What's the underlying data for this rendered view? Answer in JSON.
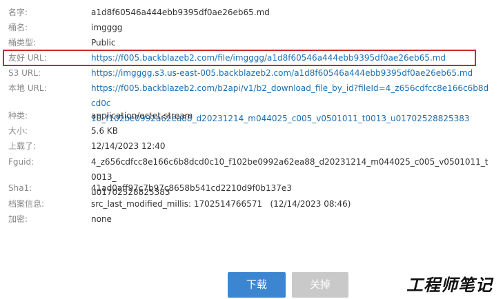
{
  "fields": {
    "name": {
      "label": "名字:",
      "value": "a1d8f60546a444ebb9395df0ae26eb65.md"
    },
    "bucket": {
      "label": "桶名:",
      "value": "imgggg"
    },
    "bucket_type": {
      "label": "桶类型:",
      "value": "Public"
    },
    "friendly_url": {
      "label": "友好 URL:",
      "value": "https://f005.backblazeb2.com/file/imgggg/a1d8f60546a444ebb9395df0ae26eb65.md"
    },
    "s3_url": {
      "label": "S3 URL:",
      "value": "https://imgggg.s3.us-east-005.backblazeb2.com/a1d8f60546a444ebb9395df0ae26eb65.md"
    },
    "native_url": {
      "label": "本地 URL:",
      "line1": "https://f005.backblazeb2.com/b2api/v1/b2_download_file_by_id?fileId=4_z656cdfcc8e166c6b8dcd0c",
      "line2": "10_f102be0992a62ea88_d20231214_m044025_c005_v0501011_t0013_u01702528825383"
    },
    "type": {
      "label": "种类:",
      "value": "application/octet-stream"
    },
    "size": {
      "label": "大小:",
      "value": "5.6 KB"
    },
    "uploaded": {
      "label": "上载了:",
      "value": "12/14/2023 12:40"
    },
    "fguid": {
      "label": "Fguid:",
      "line1": "4_z656cdfcc8e166c6b8dcd0c10_f102be0992a62ea88_d20231214_m044025_c005_v0501011_t0013_",
      "line2": "u01702528825383"
    },
    "sha1": {
      "label": "Sha1:",
      "value": "41ad0aff97c7b97c8658b541cd2210d9f0b137e3"
    },
    "file_info": {
      "label": "档案信息:",
      "value": "src_last_modified_millis: 1702514766571   (12/14/2023 08:46)"
    },
    "encryption": {
      "label": "加密:",
      "value": "none"
    }
  },
  "buttons": {
    "download": "下载",
    "close": "关掉"
  },
  "watermark": "工程师笔记",
  "colors": {
    "link": "#1a6fb5",
    "highlight_border": "#d0262f",
    "download_button": "#3c86d1",
    "close_button": "#c9c9c9"
  }
}
